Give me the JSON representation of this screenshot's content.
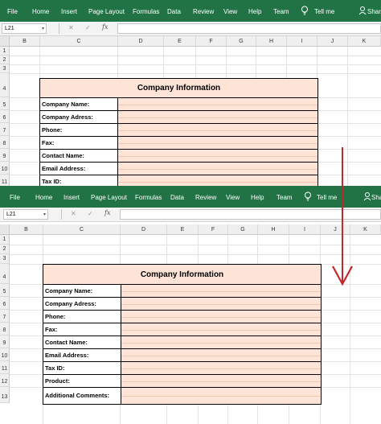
{
  "colors": {
    "ribbon_green": "#217346",
    "table_fill": "#fde4d6",
    "arrow_red": "#c0282d"
  },
  "ribbon": {
    "tabs": [
      "File",
      "Home",
      "Insert",
      "Page Layout",
      "Formulas",
      "Data",
      "Review",
      "View",
      "Help",
      "Team"
    ],
    "tell_me": "Tell me",
    "share": "Share",
    "lightbulb_icon": "lightbulb-icon"
  },
  "formula_bar": {
    "name_box": "L21",
    "name_box_dropdown": "▾",
    "cancel": "✕",
    "enter": "✓",
    "function": "fx",
    "formula": ""
  },
  "columns": [
    "B",
    "C",
    "D",
    "E",
    "F",
    "G",
    "H",
    "I",
    "J",
    "K"
  ],
  "top": {
    "rows": [
      "1",
      "2",
      "3",
      "4",
      "5",
      "6",
      "7",
      "8",
      "9",
      "10",
      "11"
    ],
    "table": {
      "title": "Company Information",
      "labels": [
        "Company Name:",
        "Company Adress:",
        "Phone:",
        "Fax:",
        "Contact Name:",
        "Email Address:",
        "Tax ID:"
      ]
    }
  },
  "bottom": {
    "rows": [
      "1",
      "2",
      "3",
      "4",
      "5",
      "6",
      "7",
      "8",
      "9",
      "10",
      "11",
      "12",
      "13"
    ],
    "table": {
      "title": "Company Information",
      "labels": [
        "Company Name:",
        "Company Adress:",
        "Phone:",
        "Fax:",
        "Contact Name:",
        "Email Address:",
        "Tax ID:",
        "Product:",
        "Additional Comments:"
      ]
    }
  }
}
